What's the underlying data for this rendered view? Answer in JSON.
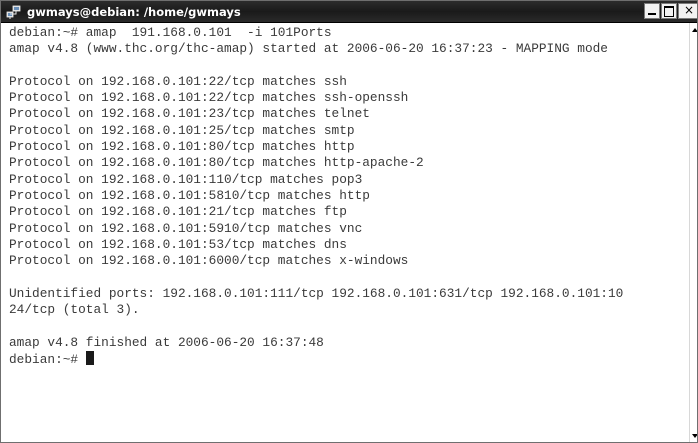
{
  "window": {
    "title": "gwmays@debian: /home/gwmays",
    "controls": {
      "minimize": "_",
      "maximize": "□",
      "close": "×"
    }
  },
  "terminal": {
    "lines": [
      "debian:~# amap  191.168.0.101  -i 101Ports",
      "amap v4.8 (www.thc.org/thc-amap) started at 2006-06-20 16:37:23 - MAPPING mode",
      "",
      "Protocol on 192.168.0.101:22/tcp matches ssh",
      "Protocol on 192.168.0.101:22/tcp matches ssh-openssh",
      "Protocol on 192.168.0.101:23/tcp matches telnet",
      "Protocol on 192.168.0.101:25/tcp matches smtp",
      "Protocol on 192.168.0.101:80/tcp matches http",
      "Protocol on 192.168.0.101:80/tcp matches http-apache-2",
      "Protocol on 192.168.0.101:110/tcp matches pop3",
      "Protocol on 192.168.0.101:5810/tcp matches http",
      "Protocol on 192.168.0.101:21/tcp matches ftp",
      "Protocol on 192.168.0.101:5910/tcp matches vnc",
      "Protocol on 192.168.0.101:53/tcp matches dns",
      "Protocol on 192.168.0.101:6000/tcp matches x-windows",
      "",
      "Unidentified ports: 192.168.0.101:111/tcp 192.168.0.101:631/tcp 192.168.0.101:10",
      "24/tcp (total 3).",
      "",
      "amap v4.8 finished at 2006-06-20 16:37:48"
    ],
    "prompt": "debian:~# "
  },
  "icons": {
    "title_icon": "network-computers-icon",
    "scroll_up": "arrow-up-icon",
    "scroll_down": "arrow-down-icon"
  }
}
